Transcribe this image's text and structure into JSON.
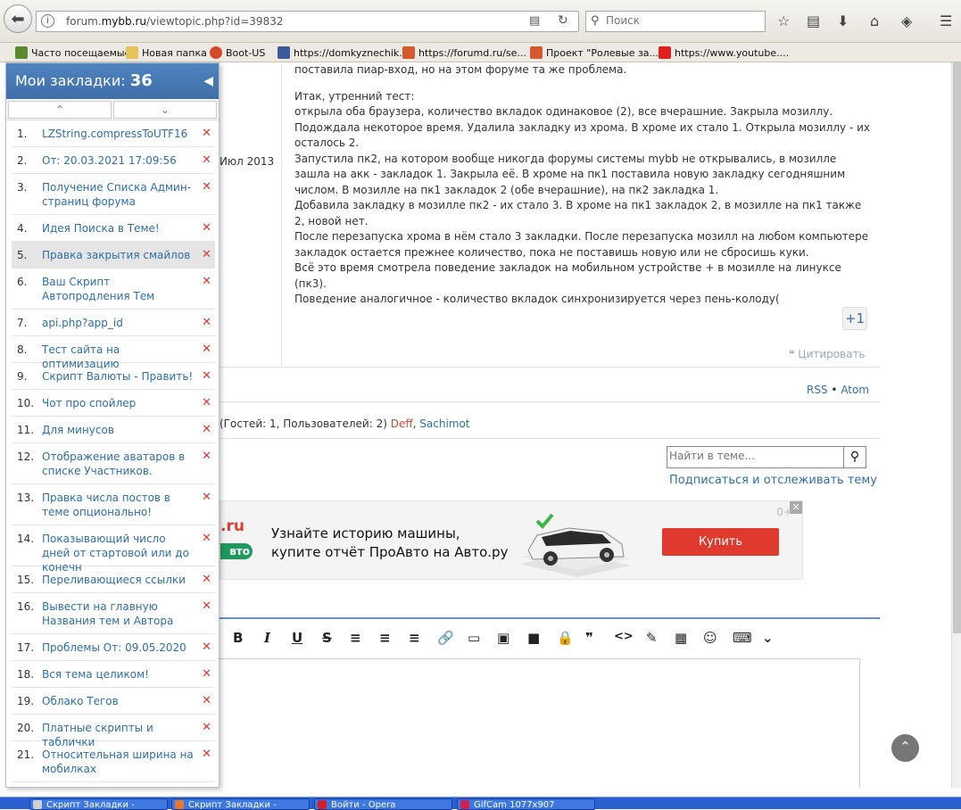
{
  "browser": {
    "url_gray": "forum.",
    "url_domain": "mybb.ru",
    "url_path": "/viewtopic.php?id=39832",
    "search_placeholder": "Поиск"
  },
  "bookmarks_bar": [
    {
      "label": "Часто посещаемые",
      "color": "#5a8a2e"
    },
    {
      "label": "Новая папка",
      "color": "#e8c25a"
    },
    {
      "label": "Boot-US",
      "color": "#d9472b"
    },
    {
      "label": "https://domkyznechik...",
      "color": "#3b5b9a"
    },
    {
      "label": "https://forumd.ru/se...",
      "color": "#d45a2e"
    },
    {
      "label": "Проект \"Ролевые за...",
      "color": "#d45a2e"
    },
    {
      "label": "https://www.youtube....",
      "color": "#e02020"
    }
  ],
  "panel": {
    "title": "Мои закладки:",
    "count": "36",
    "collapse": "◀",
    "sort_up": "⌃",
    "sort_down": "⌄",
    "items": [
      {
        "num": "1.",
        "title": "LZString.compressToUTF16"
      },
      {
        "num": "2.",
        "title": "От: 20.03.2021 17:09:56"
      },
      {
        "num": "3.",
        "title": "Получение Списка Админ-страниц форума"
      },
      {
        "num": "4.",
        "title": "Идея Поиска в Теме!"
      },
      {
        "num": "5.",
        "title": "Правка закрытия смайлов"
      },
      {
        "num": "6.",
        "title": "Ваш Скрипт Автопродления Тем"
      },
      {
        "num": "7.",
        "title": "api.php?app_id"
      },
      {
        "num": "8.",
        "title": "Тест сайта на оптимизацию"
      },
      {
        "num": "9.",
        "title": "Скрипт Валюты - Править!"
      },
      {
        "num": "10.",
        "title": "Чот про спойлер"
      },
      {
        "num": "11.",
        "title": "Для минусов"
      },
      {
        "num": "12.",
        "title": "Отображение аватаров в списке Участников."
      },
      {
        "num": "13.",
        "title": "Правка числа постов в теме опционально!"
      },
      {
        "num": "14.",
        "title": "Показывающий число дней от стартовой или до конечн"
      },
      {
        "num": "15.",
        "title": "Переливающиеся ссылки"
      },
      {
        "num": "16.",
        "title": "Вывести на главную Названия тем и Автора"
      },
      {
        "num": "17.",
        "title": "Проблемы От: 09.05.2020"
      },
      {
        "num": "18.",
        "title": "Вся тема целиком!"
      },
      {
        "num": "19.",
        "title": "Облако Тегов"
      },
      {
        "num": "20.",
        "title": "Платные скрипты и таблички"
      },
      {
        "num": "21.",
        "title": "Относительная ширина на мобилках"
      }
    ],
    "delete_glyph": "✕"
  },
  "post": {
    "date_fragment": "Июл 2013",
    "para1": "поставила пиар-вход, но на этом форуме та же проблема.",
    "para2_lines": [
      "Итак, утренний тест:",
      "открыла оба браузера, количество вкладок одинаковое (2), все вчерашние. Закрыла мозиллу. Подождала некоторое время. Удалила закладку из хрома. В хроме их стало 1. Открыла мозиллу - их осталось 2.",
      "Запустила пк2, на котором вообще никогда форумы системы mybb не открывались, в мозилле зашла на акк - закладок 1. Закрыла её. В хроме на пк1 поставила новую закладку сегодняшним числом. В мозилле на пк1 закладок 2 (обе вчерашние), на пк2 закладка 1.",
      "Добавила закладку в мозилле пк2 - их стало 3. В хроме на пк1 закладок 2, в мозилле на пк1 также 2, новой нет.",
      "После перезапуска хрома в нём стало 3 закладки. После перезапуска мозилл на любом компьютере закладок остается прежнее количество, пока не поставишь новую или не сбросишь куки.",
      "Всё это время смотрела поведение закладок на мобильном устройстве + в мозилле на линуксе (пк3).",
      "Поведение аналогичное - количество вкладок синхронизируется через пень-колоду("
    ],
    "plus_one": "+1",
    "quote_label": "Цитировать"
  },
  "footer_links": {
    "rss": "RSS",
    "sep": "•",
    "atom": "Atom"
  },
  "online": {
    "prefix": "(Гостей: 1, Пользователей: 2)",
    "user1": "Deff",
    "sep": ",",
    "user2": "Sachimot"
  },
  "topic_search": {
    "placeholder": "Найти в теме...",
    "subscribe": "Подписаться и отслеживать тему"
  },
  "ad": {
    "logo_suffix": ".ru",
    "logo_badge": "вто",
    "line1": "Узнайте историю машины,",
    "line2": "купите отчёт ПроАвто на Авто.ру",
    "buy": "Купить",
    "counter": "0+",
    "close": "✕"
  },
  "editor_tools": [
    "B",
    "I",
    "U",
    "S",
    "≡",
    "≡",
    "≡",
    "🔗",
    "▭",
    "▣",
    "■",
    "🔒",
    "❞",
    "<>",
    "✎",
    "▦",
    "☺",
    "⌨",
    "⌄"
  ],
  "taskbar": [
    {
      "label": "Скрипт Закладки -",
      "color": "#d0d0d0"
    },
    {
      "label": "Скрипт Закладки -",
      "color": "#e8762e"
    },
    {
      "label": "Войти - Opera",
      "color": "#d0202a"
    },
    {
      "label": "GifCam 1077x907",
      "color": "#d02050"
    }
  ]
}
